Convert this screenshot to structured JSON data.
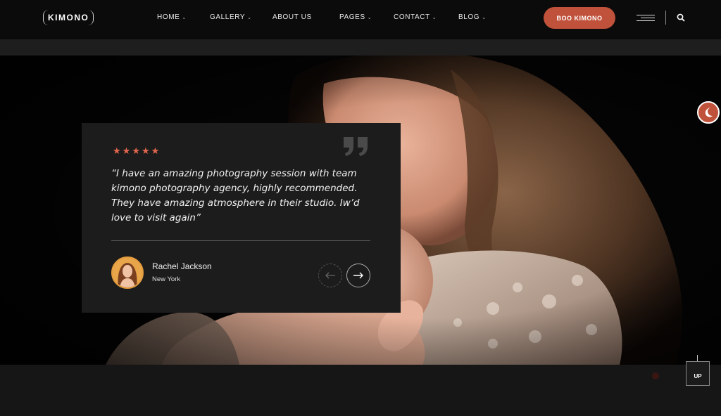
{
  "header": {
    "logo_text": "KIMONO",
    "nav": [
      {
        "label": "HOME",
        "has_dropdown": true
      },
      {
        "label": "GALLERY",
        "has_dropdown": true
      },
      {
        "label": "ABOUT US",
        "has_dropdown": false
      },
      {
        "label": "PAGES",
        "has_dropdown": true
      },
      {
        "label": "CONTACT",
        "has_dropdown": true
      },
      {
        "label": "BLOG",
        "has_dropdown": true
      }
    ],
    "cta_label": "BOO KIMONO",
    "icons": {
      "menu": "hamburger-icon",
      "search": "search-icon"
    }
  },
  "testimonial": {
    "rating": 5,
    "quote": "“I have an amazing photography session with team kimono photography agency, highly recommended. They have amazing atmosphere in their studio. Iw’d love to visit again”",
    "author_name": "Rachel Jackson",
    "author_location": "New York"
  },
  "floating": {
    "up_label": "UP",
    "theme_icon": "moon-icon"
  },
  "colors": {
    "accent": "#c0513a",
    "star": "#e5674e",
    "card_bg": "#1c1c1c"
  }
}
